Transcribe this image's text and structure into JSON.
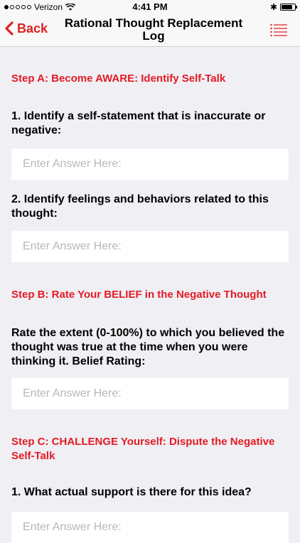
{
  "status_bar": {
    "carrier": "Verizon",
    "time": "4:41 PM",
    "battery_level": 0.85
  },
  "nav": {
    "back_label": "Back",
    "title_line1": "Rational Thought Replacement",
    "title_line2": "Log"
  },
  "form": {
    "step_a": "Step A: Become AWARE: Identify Self-Talk",
    "q1": "1. Identify a self-statement that is inaccurate or negative:",
    "q1_placeholder": "Enter Answer Here:",
    "q2": "2. Identify feelings and behaviors related to this thought:",
    "q2_placeholder": "Enter Answer Here:",
    "step_b": "Step B: Rate Your BELIEF in the Negative Thought",
    "rate": "Rate the extent (0-100%) to which you believed the thought was true at the time when you were thinking it. Belief Rating:",
    "rate_placeholder": "Enter Answer Here:",
    "step_c": "Step C: CHALLENGE Yourself: Dispute the Negative Self-Talk",
    "c1": "1. What actual support is there for this idea?",
    "c1_placeholder": "Enter Answer Here:"
  },
  "colors": {
    "accent": "#e31b23",
    "background": "#efeff4",
    "placeholder": "#b8b8bd"
  }
}
